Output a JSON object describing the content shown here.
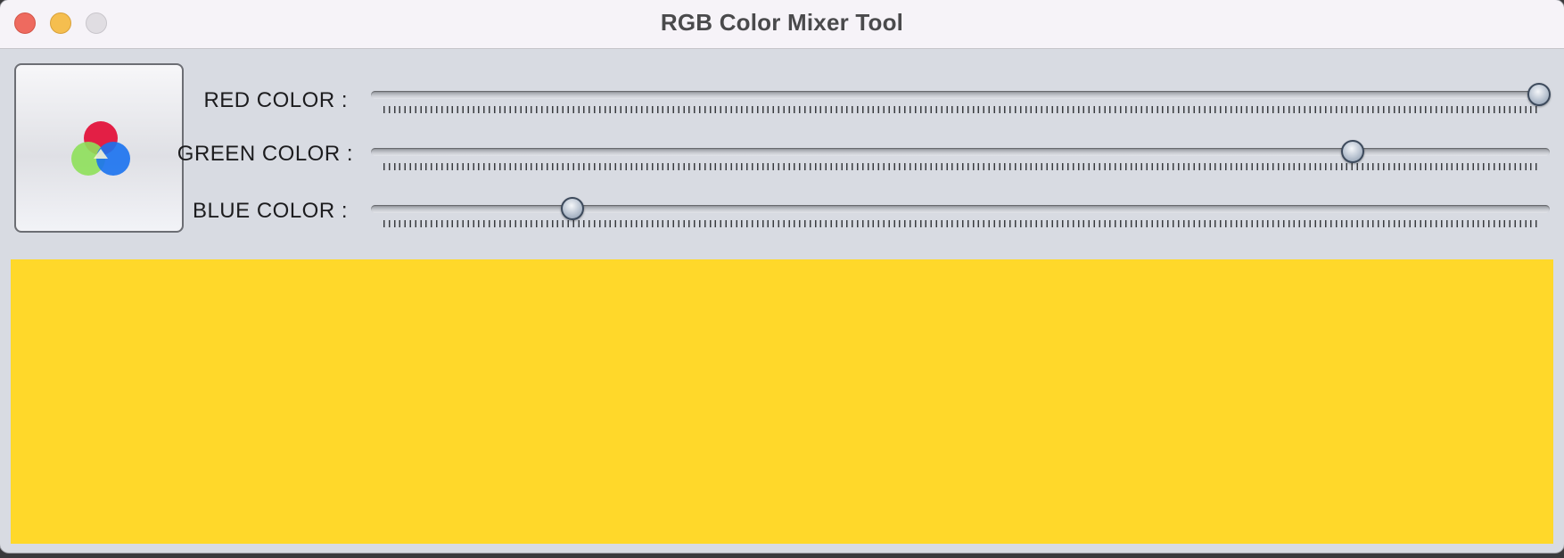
{
  "window": {
    "title": "RGB Color Mixer Tool"
  },
  "icons": {
    "close": "close-icon",
    "minimize": "minimize-icon",
    "zoom": "zoom-icon",
    "mixer": "rgb-circles-icon"
  },
  "sliders": [
    {
      "label": "RED COLOR :",
      "value": 255,
      "min": 0,
      "max": 255
    },
    {
      "label": "GREEN COLOR :",
      "value": 214,
      "min": 0,
      "max": 255
    },
    {
      "label": "BLUE COLOR :",
      "value": 42,
      "min": 0,
      "max": 255
    }
  ],
  "preview": {
    "color": "#ffd82a"
  },
  "colors": {
    "red_circle": "#e3143c",
    "green_circle": "#8ee05a",
    "blue_circle": "#1a72f0"
  }
}
